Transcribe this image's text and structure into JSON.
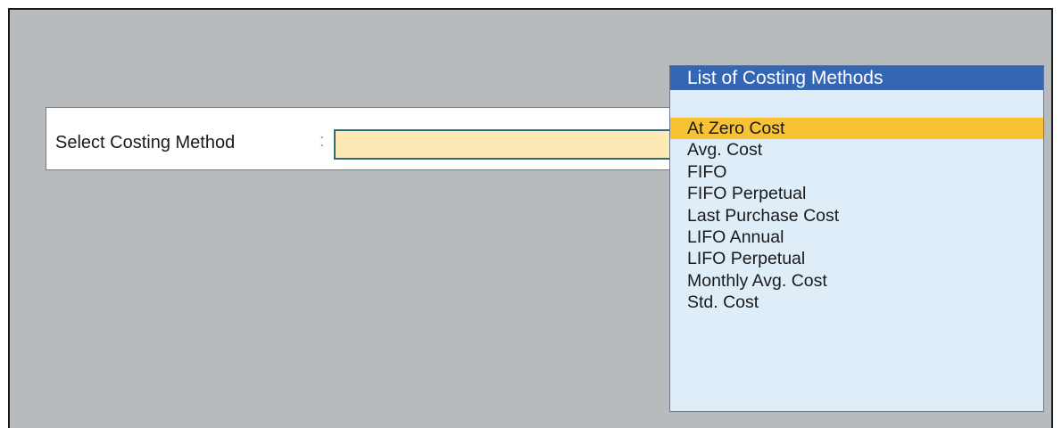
{
  "form": {
    "label": "Select Costing Method",
    "separator": ":",
    "value": ""
  },
  "list": {
    "title": "List of Costing Methods",
    "selected_index": 0,
    "items": [
      "At Zero Cost",
      "Avg. Cost",
      "FIFO",
      "FIFO Perpetual",
      "Last Purchase Cost",
      "LIFO Annual",
      "LIFO Perpetual",
      "Monthly Avg. Cost",
      "Std. Cost"
    ]
  },
  "colors": {
    "background": "#b8bbbe",
    "header": "#3566b3",
    "list_background": "#dfedf9",
    "selection": "#f8c235",
    "input_fill": "#fde9b3"
  }
}
